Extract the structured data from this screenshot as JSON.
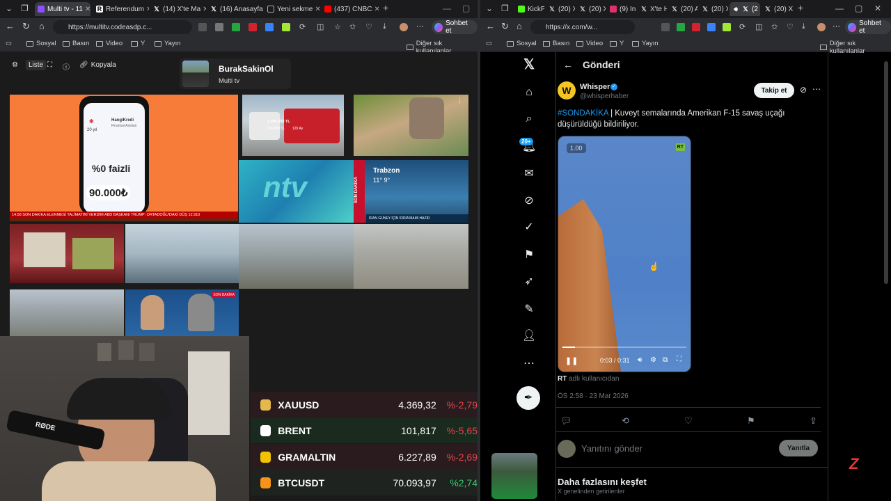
{
  "left_browser": {
    "tabs": [
      {
        "label": "Multi tv - 11"
      },
      {
        "label": "Referendum"
      },
      {
        "label": "(14) X'te Ma"
      },
      {
        "label": "(16) Anasayfa"
      },
      {
        "label": "Yeni sekme"
      },
      {
        "label": "(437) CNBC"
      }
    ],
    "url": "https://multitv.codeasdp.c...",
    "copilot_label": "Sohbet et",
    "bookmarks": [
      "Sosyal",
      "Basın",
      "Video",
      "Y",
      "Yayın"
    ],
    "bookmarks_other": "Diğer sık kullanılanlar"
  },
  "multitv": {
    "controls": {
      "list": "Liste",
      "copy": "Kopyala"
    },
    "profile": {
      "name": "BurakSakinOl",
      "subtitle": "Multi tv"
    },
    "ad": {
      "brand": "HangiKredi",
      "tagline": "Finansal Asistan",
      "years": "20 yıl",
      "offer": "%0 faizli",
      "amount": "90.000₺"
    },
    "bus": {
      "price": "1.990.000 TL",
      "price2": "995.000 TL",
      "term": "120 Ay"
    },
    "news_caption_1": "SON DAKİKA   ELENMESİ TALİMATINI VERDİM   ABD BAŞKANI TRUMP: ORTADOĞU'DAKİ DÜŞ",
    "news_ticker_time": "14:58",
    "news_ticker_value": "12.910",
    "weather": {
      "city": "Trabzon",
      "temps": "11°  9°",
      "label": "SON DAKİKA",
      "caption": "İRAN GÜNEY İÇİN İDDİA'MAMI HAZIR"
    },
    "ntv_logo": "ntv",
    "breaking": "SON DAKİKA"
  },
  "tickers": [
    {
      "name": "XAUUSD",
      "value": "4.369,32",
      "change": "%-2,79",
      "color": "#e5b84b",
      "change_color": "#e0454e"
    },
    {
      "name": "BRENT",
      "value": "101,817",
      "change": "%-5,65",
      "color": "#ffffff",
      "change_color": "#e0454e"
    },
    {
      "name": "GRAMALTIN",
      "value": "6.227,89",
      "change": "%-2,69",
      "color": "#f2c200",
      "change_color": "#e0454e"
    },
    {
      "name": "BTCUSDT",
      "value": "70.093,97",
      "change": "%2,74",
      "color": "#f7931a",
      "change_color": "#3ec46d"
    }
  ],
  "webcam": {
    "mic_brand": "RØDE"
  },
  "right_browser": {
    "tabs": [
      {
        "label": "KickPo"
      },
      {
        "label": "(20) X"
      },
      {
        "label": "(20) X"
      },
      {
        "label": "(9) Ins"
      },
      {
        "label": "X'te H"
      },
      {
        "label": "(20) A"
      },
      {
        "label": "(20) X"
      },
      {
        "label": "(2"
      },
      {
        "label": "(20) X"
      }
    ],
    "url": "https://x.com/w...",
    "copilot_label": "Sohbet et",
    "bookmarks": [
      "Sosyal",
      "Basın",
      "Video",
      "Y",
      "Yayın"
    ],
    "bookmarks_other": "Diğer sık kullanılanlar"
  },
  "x": {
    "notification_badge": "20+",
    "header_title": "Gönderi",
    "post": {
      "author": "Whisper",
      "handle": "@whisperhaber",
      "follow_label": "Takip et",
      "hashtag": "#SONDAKİKA",
      "text": " | Kuveyt semalarında Amerikan F-15 savaş uçağı düşürüldüğü bildiriliyor.",
      "video_speed": "1.00",
      "video_badge": "RT",
      "video_time": "0:03 / 0:31",
      "video_progress": 0.1,
      "from_user": "RT",
      "from_suffix": "adlı kullanıcıdan",
      "timestamp": "ÖS 2:58 · 23 Mar 2026"
    },
    "reply": {
      "placeholder": "Yanıtını gönder",
      "button": "Yanıtla"
    },
    "explore": {
      "title": "Daha fazlasını keşfet",
      "subtitle": "X genelinden getirilenler"
    }
  },
  "colors": {
    "x_blue": "#1d9bf0",
    "mtv_orange": "#f77c3a",
    "red": "#e0454e",
    "green": "#3ec46d"
  }
}
